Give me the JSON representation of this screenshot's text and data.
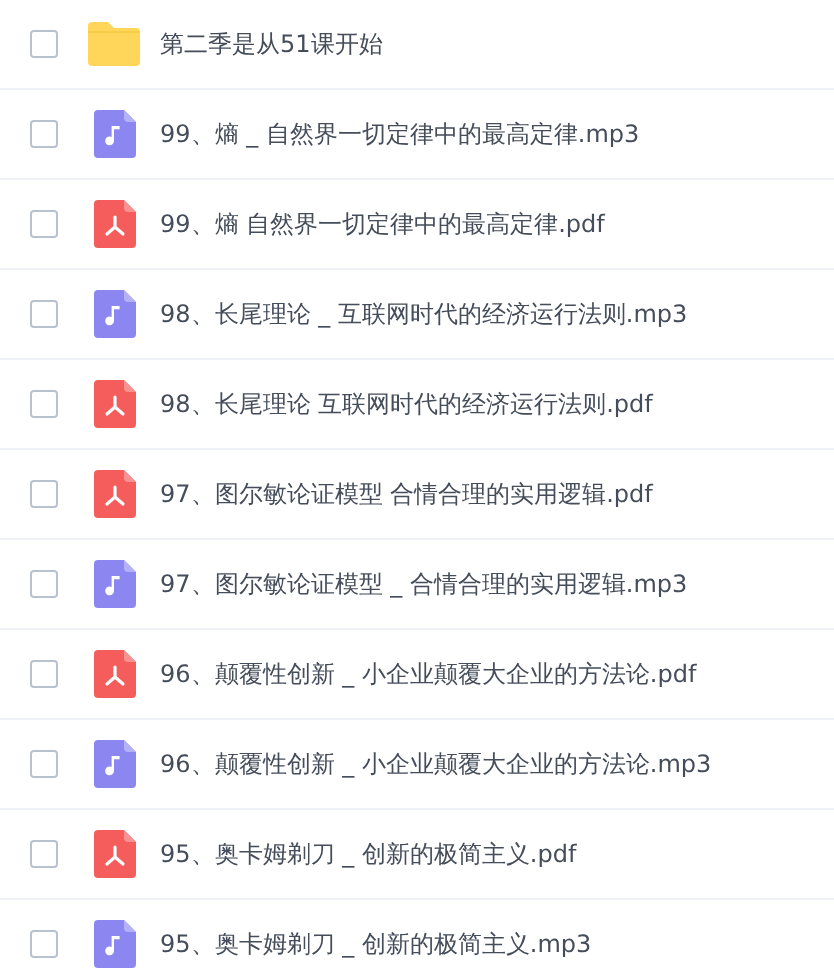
{
  "files": [
    {
      "kind": "folder",
      "name": "第二季是从51课开始",
      "checked": false
    },
    {
      "kind": "audio",
      "name": "99、熵 _ 自然界一切定律中的最高定律.mp3",
      "checked": false
    },
    {
      "kind": "pdf",
      "name": "99、熵 自然界一切定律中的最高定律.pdf",
      "checked": false
    },
    {
      "kind": "audio",
      "name": "98、长尾理论 _ 互联网时代的经济运行法则.mp3",
      "checked": false
    },
    {
      "kind": "pdf",
      "name": "98、长尾理论 互联网时代的经济运行法则.pdf",
      "checked": false
    },
    {
      "kind": "pdf",
      "name": "97、图尔敏论证模型 合情合理的实用逻辑.pdf",
      "checked": false
    },
    {
      "kind": "audio",
      "name": "97、图尔敏论证模型 _ 合情合理的实用逻辑.mp3",
      "checked": false
    },
    {
      "kind": "pdf",
      "name": "96、颠覆性创新 _ 小企业颠覆大企业的方法论.pdf",
      "checked": false
    },
    {
      "kind": "audio",
      "name": "96、颠覆性创新 _ 小企业颠覆大企业的方法论.mp3",
      "checked": false
    },
    {
      "kind": "pdf",
      "name": "95、奥卡姆剃刀 _ 创新的极简主义.pdf",
      "checked": false
    },
    {
      "kind": "audio",
      "name": "95、奥卡姆剃刀 _ 创新的极简主义.mp3",
      "checked": false
    }
  ]
}
